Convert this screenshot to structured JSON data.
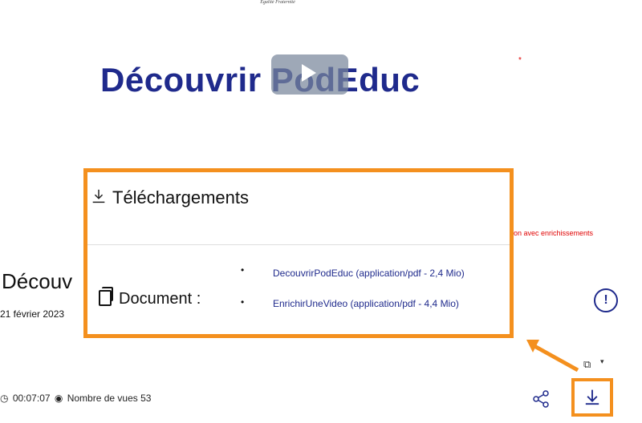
{
  "header": {
    "motto": "Égalité\nFraternité"
  },
  "video": {
    "title": "Découvrir PodEduc",
    "enrich_label": "on avec enrichissements",
    "page_heading": "Découv",
    "date": "21 février 2023",
    "duration": "00:07:07",
    "views_label": "Nombre de vues 53"
  },
  "downloads_panel": {
    "title": "Téléchargements",
    "document_label": "Document :",
    "files": [
      {
        "label": "DecouvrirPodEduc (application/pdf - 2,4 Mio)"
      },
      {
        "label": "EnrichirUneVideo (application/pdf - 4,4 Mio)"
      }
    ]
  },
  "colors": {
    "accent": "#f4901e",
    "brand": "#1f2a8c",
    "alert": "#e00000"
  },
  "icons": [
    "play-icon",
    "report-icon",
    "layers-icon",
    "share-icon",
    "download-icon",
    "clock-icon",
    "eye-icon",
    "document-icon"
  ]
}
